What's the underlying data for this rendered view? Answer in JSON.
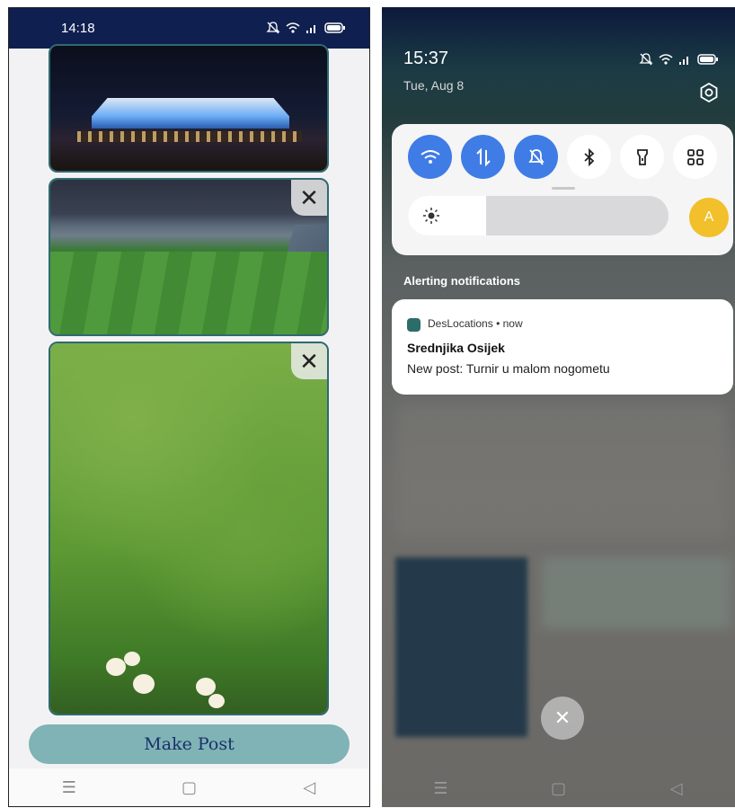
{
  "left_screen": {
    "status_bar": {
      "time": "14:18"
    },
    "images": [
      {
        "name": "stadium-night-photo",
        "has_close": false
      },
      {
        "name": "stadium-day-photo",
        "has_close": true,
        "close_label": "✕"
      },
      {
        "name": "grass-photo",
        "has_close": true,
        "close_label": "✕"
      }
    ],
    "make_post_label": "Make Post",
    "nav": {
      "menu": "☰",
      "home": "▢",
      "back": "◁"
    }
  },
  "right_screen": {
    "status_bar": {
      "time": "15:37",
      "date": "Tue, Aug 8"
    },
    "quick_settings": {
      "tiles": [
        {
          "name": "wifi",
          "state": "on"
        },
        {
          "name": "mobile-data",
          "state": "on"
        },
        {
          "name": "do-not-disturb",
          "state": "on"
        },
        {
          "name": "bluetooth",
          "state": "off"
        },
        {
          "name": "flashlight",
          "state": "off"
        },
        {
          "name": "more-apps",
          "state": "off"
        }
      ],
      "brightness_level": 0.3,
      "auto_brightness_label": "A"
    },
    "alert_section_header": "Alerting notifications",
    "notification": {
      "app_name": "DesLocations",
      "separator": "•",
      "time": "now",
      "title": "Srednjika Osijek",
      "body": "New post: Turnir u malom nogometu"
    },
    "clear_all_label": "✕",
    "nav": {
      "menu": "☰",
      "home": "▢",
      "back": "◁"
    }
  },
  "colors": {
    "left_status_bar": "#0f1f4f",
    "make_post_button": "#7fb3b5",
    "make_post_text": "#1c2f6b",
    "card_border": "#2e6a70",
    "qs_active": "#3f7ce6",
    "auto_brightness": "#f1c02a"
  }
}
